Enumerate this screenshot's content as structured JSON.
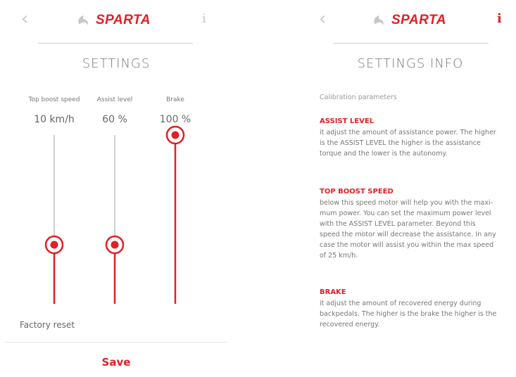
{
  "app": {
    "brand": "SPARTA",
    "brand_color": "#e21f26",
    "back_icon": "chevron-left-icon",
    "info_label": "i"
  },
  "settings": {
    "title": "SETTINGS",
    "sliders": [
      {
        "label": "Top boost speed",
        "value": "10 km/h",
        "level": 0.35
      },
      {
        "label": "Assist level",
        "value": "60 %",
        "level": 0.35
      },
      {
        "label": "Brake",
        "value": "100 %",
        "level": 1.0
      }
    ],
    "factory_reset_label": "Factory reset",
    "save_label": "Save"
  },
  "info": {
    "title": "SETTINGS INFO",
    "subtitle": "Calibration parameters",
    "sections": [
      {
        "heading": "ASSIST LEVEL",
        "lines": [
          "it adjust the amount of assistance power. The higher",
          "is the ASSIST LEVEL the higher is the assistance",
          "torque and the lower is the autonomy."
        ]
      },
      {
        "heading": "TOP BOOST SPEED",
        "lines": [
          "below this speed motor will help you with the maxi-",
          "mum power. You can set the maximum power level",
          "with the ASSIST LEVEL parameter. Beyond this",
          "speed the motor will decrease the assistance. In any",
          "case the motor will assist you within the max speed",
          "of 25 km/h."
        ]
      },
      {
        "heading": "BRAKE",
        "lines": [
          "it adjust the amount of recovered energy during",
          "backpedals. The higher is the brake the higher is the",
          "recovered energy."
        ]
      }
    ]
  }
}
